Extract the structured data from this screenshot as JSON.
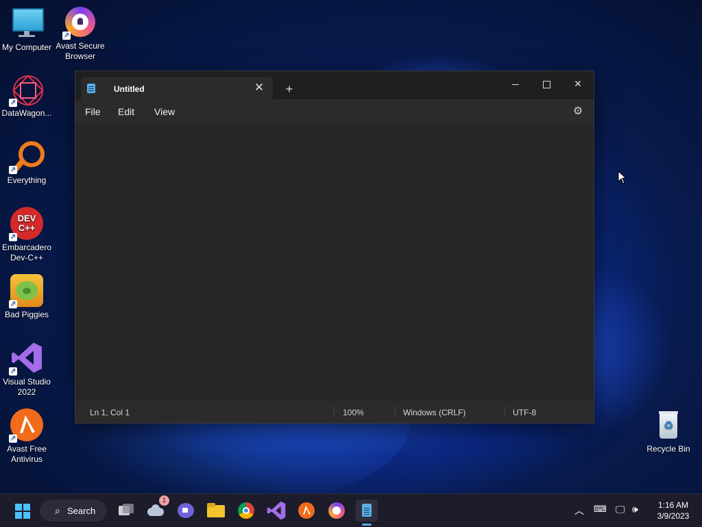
{
  "desktop": {
    "icons": [
      {
        "label": "My Computer"
      },
      {
        "label": "Avast Secure Browser"
      },
      {
        "label": "DataWagon..."
      },
      {
        "label": "Everything"
      },
      {
        "label": "Embarcadero Dev-C++"
      },
      {
        "label": "Bad Piggies"
      },
      {
        "label": "Visual Studio 2022"
      },
      {
        "label": "Avast Free Antivirus"
      },
      {
        "label": "Recycle Bin"
      }
    ],
    "devcpp_logo_text": "DEV C++"
  },
  "notepad": {
    "tab_title": "Untitled",
    "menu": {
      "file": "File",
      "edit": "Edit",
      "view": "View"
    },
    "status": {
      "position": "Ln 1, Col 1",
      "zoom": "100%",
      "line_ending": "Windows (CRLF)",
      "encoding": "UTF-8"
    }
  },
  "taskbar": {
    "search_label": "Search",
    "onedrive_badge": "1",
    "clock_time": "1:16 AM",
    "clock_date": "3/9/2023"
  },
  "colors": {
    "accent": "#4cc2ff",
    "notepad_icon": "#5aaee8",
    "window_bg": "#272727",
    "taskbar_bg": "#1c1c2a"
  }
}
